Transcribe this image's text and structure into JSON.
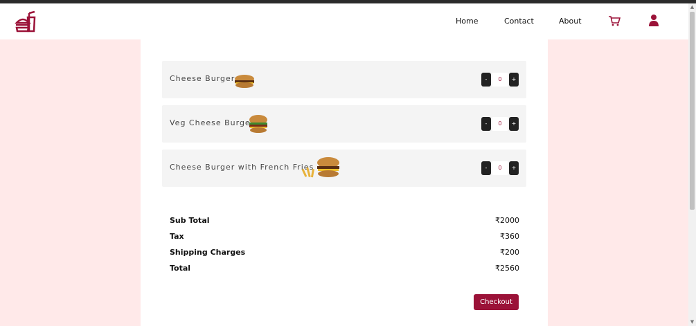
{
  "nav": {
    "logo_icon": "fast-food-logo-icon",
    "links": [
      "Home",
      "Contact",
      "About"
    ],
    "cart_icon": "cart-icon",
    "user_icon": "user-icon",
    "accent_color": "#9b1238"
  },
  "cart": {
    "items": [
      {
        "name": "Cheese Burger",
        "quantity": "0",
        "minus_label": "-",
        "plus_label": "+",
        "image_icon": "cheese-burger-image"
      },
      {
        "name": "Veg Cheese Burger",
        "quantity": "0",
        "minus_label": "-",
        "plus_label": "+",
        "image_icon": "veg-cheese-burger-image"
      },
      {
        "name": "Cheese Burger with French Fries",
        "quantity": "0",
        "minus_label": "-",
        "plus_label": "+",
        "image_icon": "burger-fries-image"
      }
    ]
  },
  "summary": {
    "rows": [
      {
        "label": "Sub Total",
        "value": "₹2000"
      },
      {
        "label": "Tax",
        "value": "₹360"
      },
      {
        "label": "Shipping Charges",
        "value": "₹200"
      },
      {
        "label": "Total",
        "value": "₹2560"
      }
    ],
    "checkout_label": "Checkout"
  }
}
